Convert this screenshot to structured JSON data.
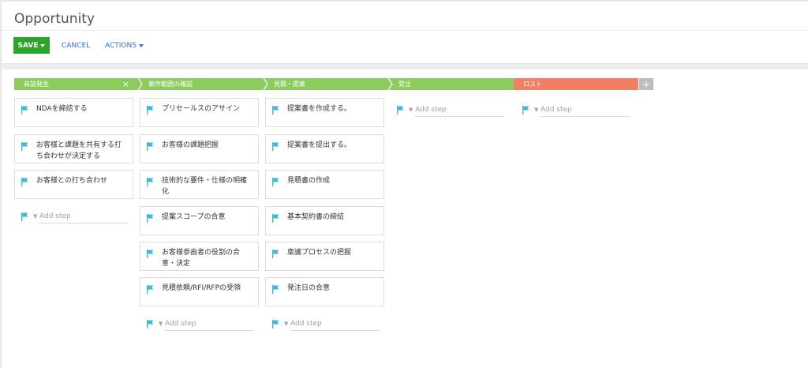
{
  "page": {
    "title": "Opportunity"
  },
  "toolbar": {
    "save_label": "SAVE",
    "cancel_label": "CANCEL",
    "actions_label": "ACTIONS"
  },
  "stages": [
    {
      "label": "商談発生",
      "color": "#8ccc5e",
      "close_icon": "×"
    },
    {
      "label": "案件範囲の確認",
      "color": "#8ccc5e"
    },
    {
      "label": "見積・提案",
      "color": "#8ccc5e"
    },
    {
      "label": "受注",
      "color": "#8ccc5e"
    },
    {
      "label": "ロスト",
      "color": "#f07f63"
    }
  ],
  "add_stage_label": "+",
  "flag_color": "#3bb8d9",
  "add_step_placeholder": "Add step",
  "columns": [
    {
      "steps": [
        "NDAを締結する",
        "お客様と課題を共有する打ち合わせが決定する",
        "お客様との打ち合わせ"
      ]
    },
    {
      "steps": [
        "プリセールスのアサイン",
        "お客様の課題把握",
        "技術的な要件・仕様の明確化",
        "提案スコープの合意",
        "お客様参画者の役割の合意・決定",
        "見積依頼/RFI/RFPの受領"
      ]
    },
    {
      "steps": [
        "提案書を作成する。",
        "提案書を提出する。",
        "見積書の作成",
        "基本契約書の締結",
        "稟議プロセスの把握",
        "発注日の合意"
      ]
    },
    {
      "steps": []
    },
    {
      "steps": []
    }
  ]
}
